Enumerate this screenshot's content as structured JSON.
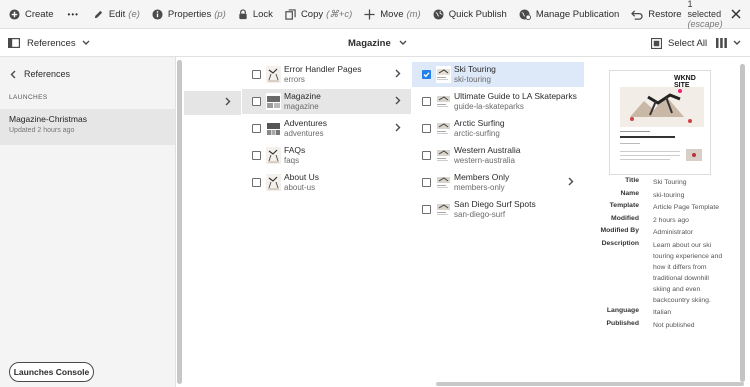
{
  "toolbar": {
    "create": "Create",
    "more": "•••",
    "edit": "Edit",
    "edit_kbd": "(e)",
    "properties": "Properties",
    "properties_kbd": "(p)",
    "lock": "Lock",
    "copy": "Copy",
    "copy_kbd": "(⌘+c)",
    "move": "Move",
    "move_kbd": "(m)",
    "quick_publish": "Quick Publish",
    "manage_publication": "Manage Publication",
    "restore": "Restore",
    "selection_status": "1 selected",
    "selection_kbd": "(escape)"
  },
  "subbar": {
    "rail_label": "References",
    "title": "Magazine",
    "select_all": "Select All"
  },
  "rail": {
    "back_label": "References",
    "section": "LAUNCHES",
    "items": [
      {
        "name": "Magazine-Christmas",
        "status": "Updated 2 hours ago"
      }
    ],
    "console_button": "Launches Console"
  },
  "columns": {
    "col2": [
      {
        "title": "Error Handler Pages",
        "name": "errors"
      },
      {
        "title": "Magazine",
        "name": "magazine"
      },
      {
        "title": "Adventures",
        "name": "adventures"
      },
      {
        "title": "FAQs",
        "name": "faqs"
      },
      {
        "title": "About Us",
        "name": "about-us"
      }
    ],
    "col3": [
      {
        "title": "Ski Touring",
        "name": "ski-touring"
      },
      {
        "title": "Ultimate Guide to LA Skateparks",
        "name": "guide-la-skateparks"
      },
      {
        "title": "Arctic Surfing",
        "name": "arctic-surfing"
      },
      {
        "title": "Western Australia",
        "name": "western-australia"
      },
      {
        "title": "Members Only",
        "name": "members-only"
      },
      {
        "title": "San Diego Surf Spots",
        "name": "san-diego-surf"
      }
    ]
  },
  "preview": {
    "logo": "WKND SITE",
    "meta": [
      {
        "label": "Title",
        "value": "Ski Touring"
      },
      {
        "label": "Name",
        "value": "ski-touring"
      },
      {
        "label": "Template",
        "value": "Article Page Template"
      },
      {
        "label": "Modified",
        "value": "2 hours ago"
      },
      {
        "label": "Modified By",
        "value": "Administrator"
      },
      {
        "label": "Description",
        "value": "Learn about our ski touring experience and how it differs from traditional downhill skiing and even backcountry skiing."
      },
      {
        "label": "Language",
        "value": "Italian"
      },
      {
        "label": "Published",
        "value": "Not published"
      }
    ]
  },
  "colors": {
    "accent": "#2680eb",
    "selected_row": "#dde8f8",
    "rail_bg": "#f4f4f4"
  }
}
